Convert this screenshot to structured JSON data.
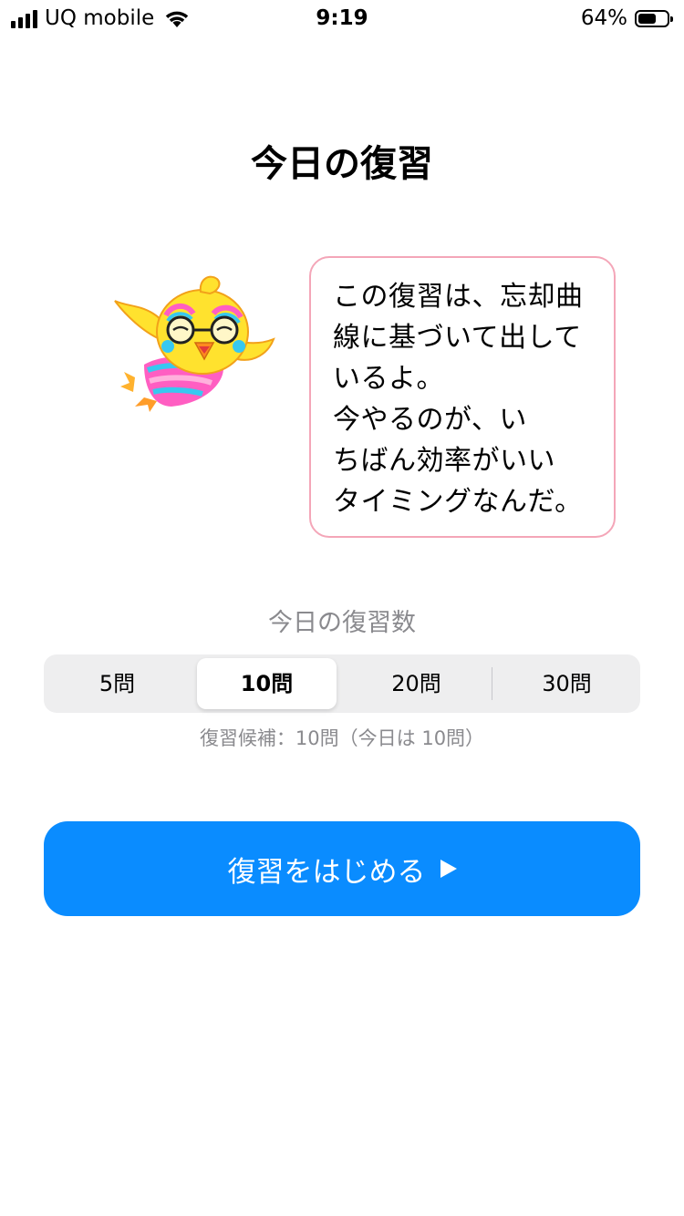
{
  "status_bar": {
    "carrier": "UQ mobile",
    "time": "9:19",
    "battery_percent": "64%",
    "battery_level": 0.64,
    "signal_bars": 4
  },
  "page": {
    "title": "今日の復習"
  },
  "mascot": {
    "icon": "owl-mascot-icon"
  },
  "bubble": {
    "text": "この復習は、忘却曲\n線に基づいて出して\nいるよ。\n今やるのが、い\nちばん効率がいい\nタイミングなんだ。"
  },
  "review_count": {
    "label": "今日の復習数",
    "options": [
      "5問",
      "10問",
      "20問",
      "30問"
    ],
    "selected": "10問",
    "candidates_text": "復習候補：10問（今日は 10問）"
  },
  "start_button": {
    "label": "復習をはじめる",
    "icon": "play-icon"
  },
  "colors": {
    "accent_blue": "#0a8cff",
    "bubble_border": "#f4a6b8",
    "secondary_text": "#8a8a8e",
    "segment_bg": "#eeeeef"
  }
}
